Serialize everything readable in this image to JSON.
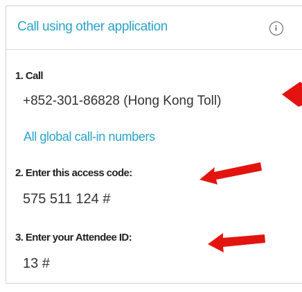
{
  "panel": {
    "title": "Call using other application",
    "info_icon": "info-icon"
  },
  "steps": [
    {
      "label": "1. Call",
      "value": "+852-301-86828 (Hong Kong Toll)"
    },
    {
      "label": "2. Enter this access code:",
      "value": "575 511 124 #"
    },
    {
      "label": "3. Enter your Attendee ID:",
      "value": "13 #"
    }
  ],
  "global_numbers_link": "All global call-in numbers",
  "annotations": {
    "arrow_color": "#e3140f",
    "arrow_icon": "red-arrow-annotation"
  },
  "colors": {
    "accent": "#2aa2c9",
    "text": "#222222"
  }
}
